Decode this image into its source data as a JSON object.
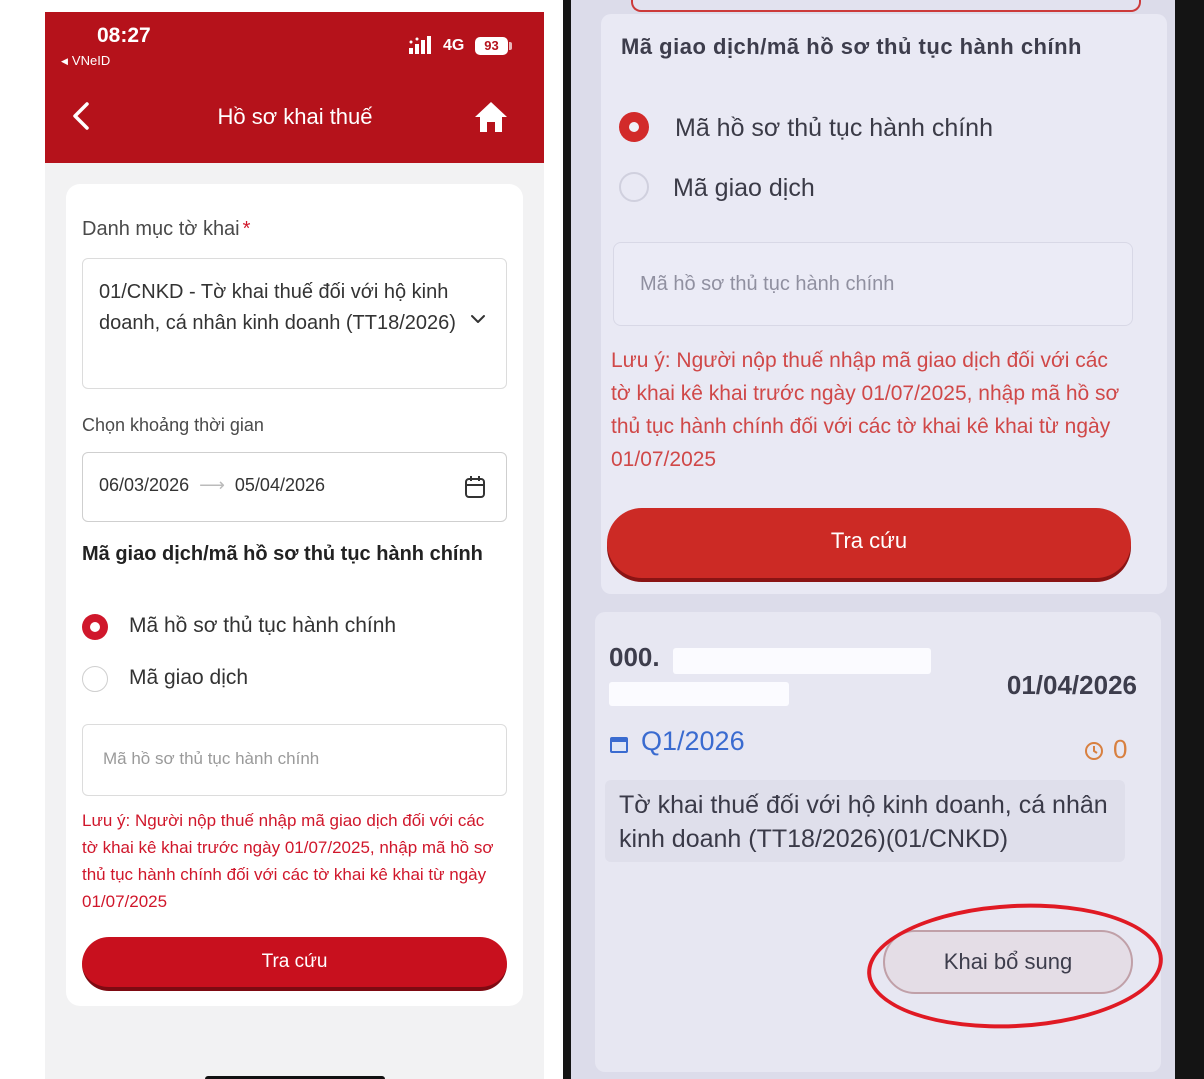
{
  "status_bar": {
    "time": "08:27",
    "carrier": "VNeID",
    "network": "4G",
    "battery": "93"
  },
  "header": {
    "title": "Hồ sơ khai thuế",
    "back_icon": "chevron-left-icon",
    "home_icon": "home-icon"
  },
  "colors": {
    "brand": "#b5121b",
    "accent_red": "#d0172b",
    "link_blue": "#3a6bd0"
  },
  "form": {
    "category_label": "Danh mục tờ khai",
    "required_mark": "*",
    "category_value": "01/CNKD - Tờ khai thuế đối với hộ kinh doanh, cá nhân kinh doanh (TT18/2026)",
    "period_label": "Chọn khoảng thời gian",
    "date_from": "06/03/2026",
    "date_to": "05/04/2026",
    "code_section_title": "Mã giao dịch/mã hồ sơ thủ tục hành chính",
    "option_1": "Mã hồ sơ thủ tục hành chính",
    "option_2": "Mã giao dịch",
    "selected_option": "Mã hồ sơ thủ tục hành chính",
    "code_placeholder": "Mã hồ sơ thủ tục hành chính",
    "note": "Lưu ý: Người nộp thuế nhập mã giao dịch đối với các tờ khai kê khai trước ngày 01/07/2025, nhập mã hồ sơ thủ tục hành chính đối với các tờ khai kê khai từ ngày 01/07/2025",
    "search_button": "Tra cứu"
  },
  "result": {
    "code_prefix": "000.",
    "date": "01/04/2026",
    "period": "Q1/2026",
    "count": "0",
    "description": "Tờ khai thuế đối với hộ kinh doanh, cá nhân kinh doanh (TT18/2026)(01/CNKD)",
    "supplement_button": "Khai bổ sung"
  }
}
